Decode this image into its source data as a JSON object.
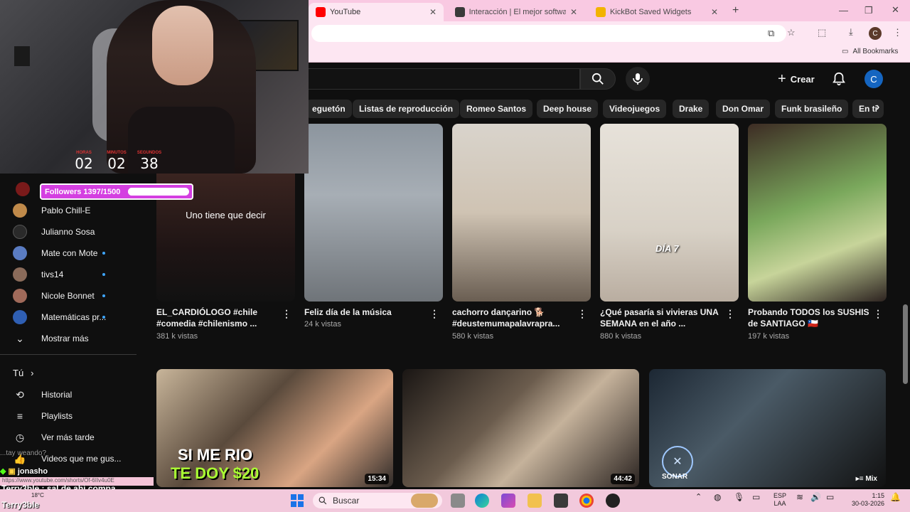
{
  "browser": {
    "tabs": [
      {
        "title": "YouTube",
        "active": true,
        "color": "#ff0000"
      },
      {
        "title": "Interacción | El mejor software p",
        "active": false,
        "color": "#3a3a3a"
      },
      {
        "title": "KickBot Saved Widgets",
        "active": false,
        "color": "#f2b300"
      }
    ],
    "new_tab": "+",
    "profile_initial": "C",
    "all_bookmarks": "All Bookmarks"
  },
  "youtube": {
    "create_label": "Crear",
    "avatar_initial": "C",
    "chips": [
      "eguetón",
      "Listas de reproducción",
      "Romeo Santos",
      "Deep house",
      "Videojuegos",
      "Drake",
      "Don Omar",
      "Funk brasileño",
      "En ti"
    ],
    "sidebar": {
      "subscriptions": [
        {
          "name": "Pablo Chill-E",
          "dot": false,
          "color": "#c08a4a"
        },
        {
          "name": "Julianno Sosa",
          "dot": false,
          "color": "#2a2a2a"
        },
        {
          "name": "Mate con Mote",
          "dot": true,
          "color": "#5a7cc2"
        },
        {
          "name": "tivs14",
          "dot": true,
          "color": "#8a6b5a"
        },
        {
          "name": "Nicole Bonnet",
          "dot": true,
          "color": "#a06a5a"
        },
        {
          "name": "Matemáticas pr...",
          "dot": true,
          "color": "#2f5fb3"
        }
      ],
      "show_more": "Mostrar más",
      "you_label": "Tú",
      "you_items": [
        {
          "label": "Historial",
          "icon": "history-icon",
          "glyph": "⟲"
        },
        {
          "label": "Playlists",
          "icon": "playlists-icon",
          "glyph": "≡"
        },
        {
          "label": "Ver más tarde",
          "icon": "watch-later-icon",
          "glyph": "◷"
        },
        {
          "label": "Videos que me gus...",
          "icon": "like-icon",
          "glyph": "👍"
        }
      ]
    },
    "shorts": [
      {
        "title": "EL_CARDIÓLOGO #chile #comedia #chilenismo ...",
        "views": "381 k vistas",
        "overlay": "Uno tiene que decir"
      },
      {
        "title": "Feliz día de la música",
        "views": "24 k vistas"
      },
      {
        "title": "cachorro dançarino 🐕 #deustemumapalavrapra...",
        "views": "580 k vistas"
      },
      {
        "title": "¿Qué pasaría si vivieras UNA SEMANA en el año ...",
        "views": "880 k vistas",
        "overlay": "DÍA 7"
      },
      {
        "title": "Probando TODOS los SUSHIS de SANTIAGO 🇨🇱",
        "views": "197 k vistas"
      }
    ],
    "videos": [
      {
        "duration": "15:34",
        "overlay_line1": "SI ME RIO",
        "overlay_line2": "TE DOY $20"
      },
      {
        "duration": "44:42"
      },
      {
        "duration": "Mix",
        "overlay": "SONAR"
      }
    ]
  },
  "stream": {
    "timer": [
      {
        "label": "HORAS",
        "value": "02"
      },
      {
        "label": "MINUTOS",
        "value": "02"
      },
      {
        "label": "SEGUNDOS",
        "value": "38"
      }
    ],
    "followers_text": "Followers 1397/1500",
    "followers_progress": 0.931,
    "chat": [
      {
        "user": "jonasho",
        "message": ""
      },
      {
        "user": "Terry3ble",
        "message": "sal de ahi compa"
      },
      {
        "user": "Terry3ble",
        "message": ""
      }
    ],
    "chat_faded": "...tay weando?",
    "status_url": "https://www.youtube.com/shorts/Of-6IIv4u0E"
  },
  "taskbar": {
    "search_label": "Buscar",
    "weather": "18°C",
    "lang_line1": "ESP",
    "lang_line2": "LAA",
    "time": "1:15",
    "date": "30-03-2026"
  }
}
